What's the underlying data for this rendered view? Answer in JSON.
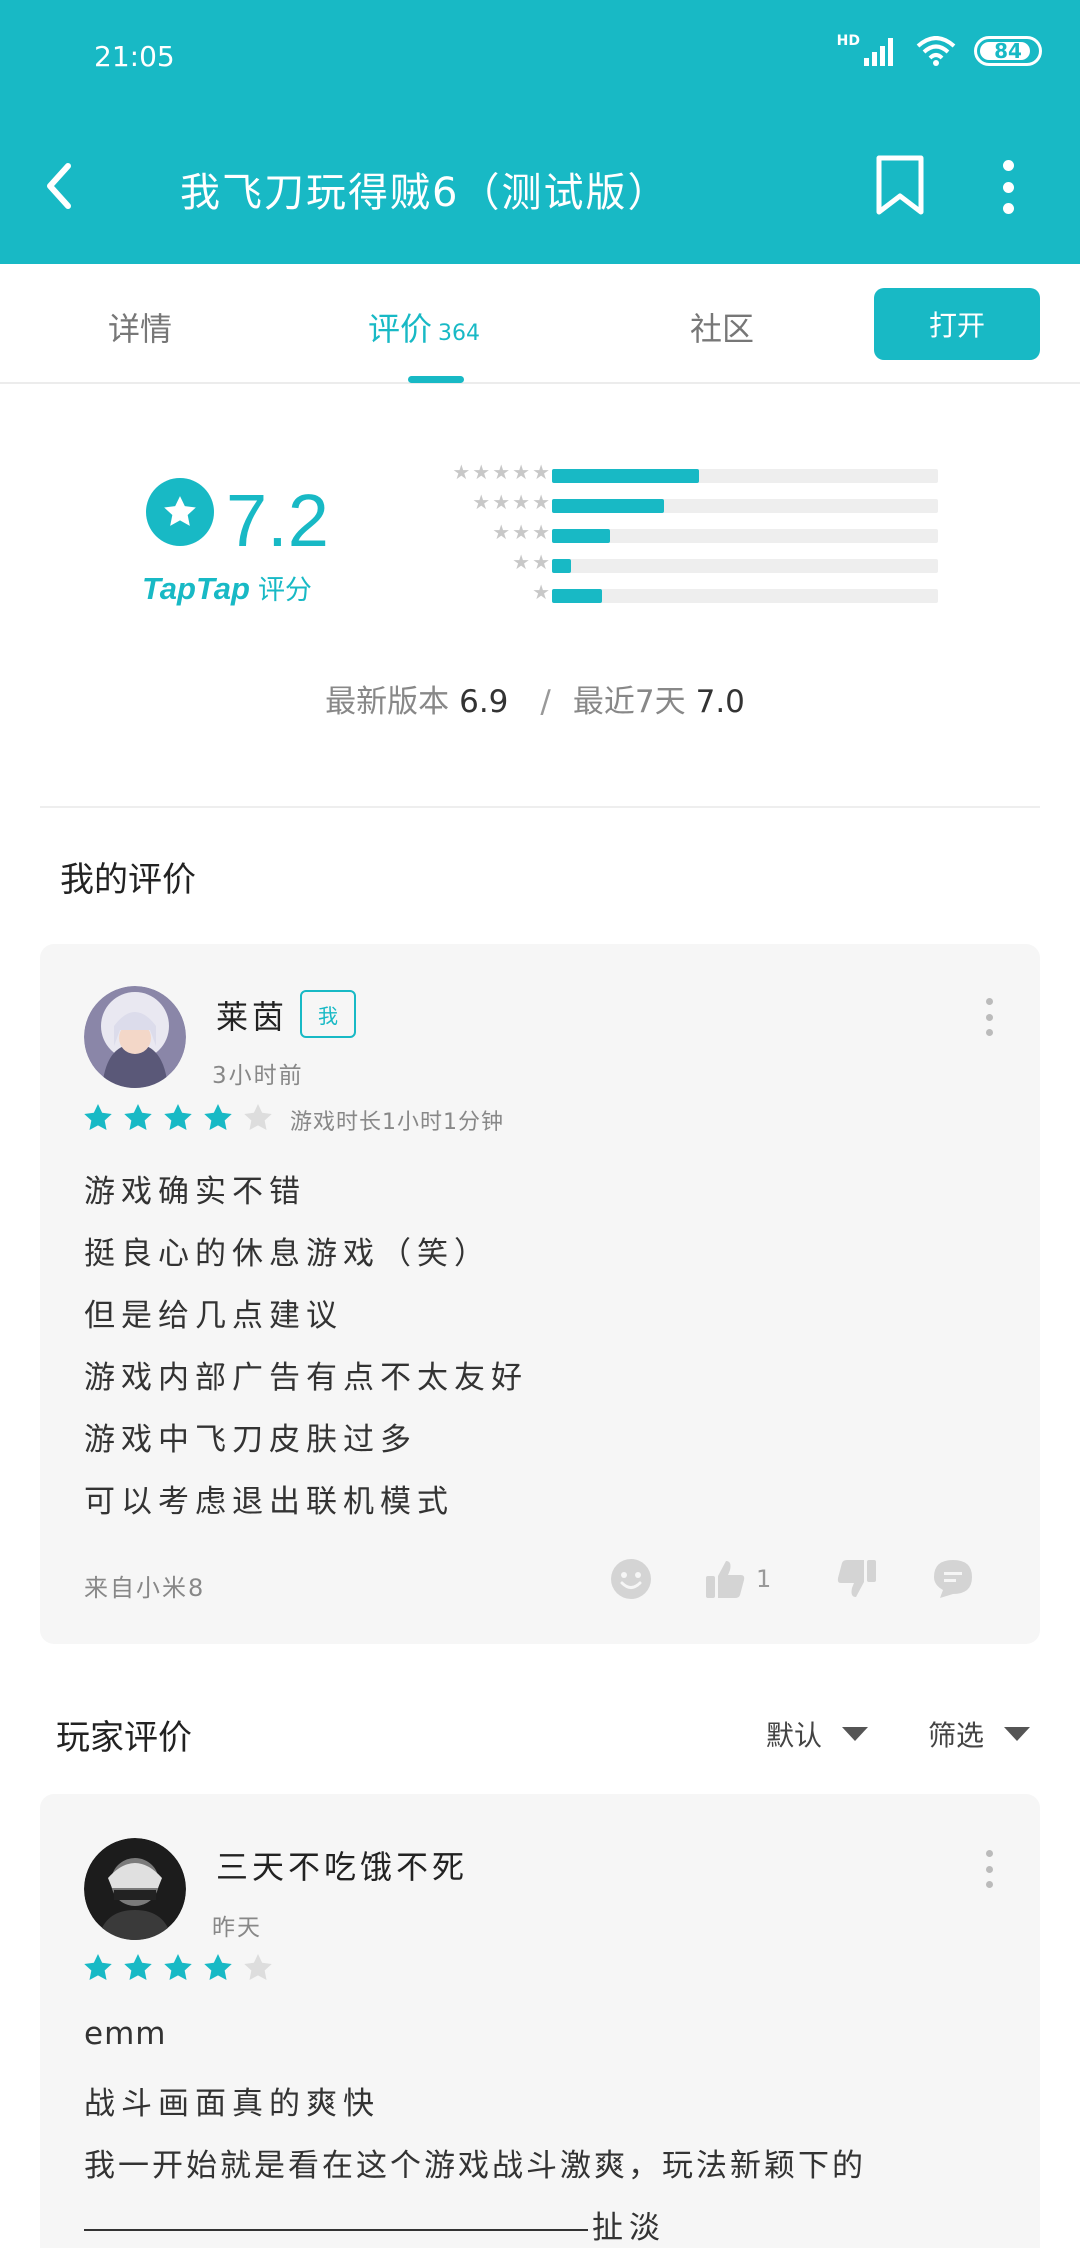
{
  "status_bar": {
    "time": "21:05",
    "network": "HD",
    "battery": "84"
  },
  "header": {
    "title": "我飞刀玩得贼6（测试版）"
  },
  "tabs": {
    "details": "详情",
    "reviews": "评价",
    "reviews_count": "364",
    "community": "社区",
    "open_button": "打开"
  },
  "rating": {
    "score": "7.2",
    "brand": "TapTap",
    "brand_suffix": "评分",
    "distribution": [
      {
        "stars": "★★★★★",
        "fraction": 0.38
      },
      {
        "stars": "★★★★",
        "fraction": 0.29
      },
      {
        "stars": "★★★",
        "fraction": 0.15
      },
      {
        "stars": "★★",
        "fraction": 0.05
      },
      {
        "stars": "★",
        "fraction": 0.13
      }
    ],
    "latest_version_label": "最新版本",
    "latest_version_score": "6.9",
    "separator": "/",
    "recent_label": "最近7天",
    "recent_score": "7.0"
  },
  "my_review": {
    "section_title": "我的评价",
    "username": "莱茵",
    "badge": "我",
    "time": "3小时前",
    "stars": 4,
    "playtime": "游戏时长1小时1分钟",
    "lines": [
      "游戏确实不错",
      "挺良心的休息游戏（笑）",
      "但是给几点建议",
      "游戏内部广告有点不太友好",
      "游戏中飞刀皮肤过多",
      "可以考虑退出联机模式"
    ],
    "device": "来自小米8",
    "likes": "1"
  },
  "player_reviews": {
    "section_title": "玩家评价",
    "sort_label": "默认",
    "filter_label": "筛选",
    "first": {
      "username": "三天不吃饿不死",
      "time": "昨天",
      "stars": 4,
      "lines": [
        "emm",
        "战斗画面真的爽快",
        "我一开始就是看在这个游戏战斗激爽，玩法新颖下的",
        "扯淡"
      ]
    }
  },
  "colors": {
    "accent": "#18b9c5",
    "card_bg": "#f6f6f6",
    "star_empty": "#dddddd"
  }
}
